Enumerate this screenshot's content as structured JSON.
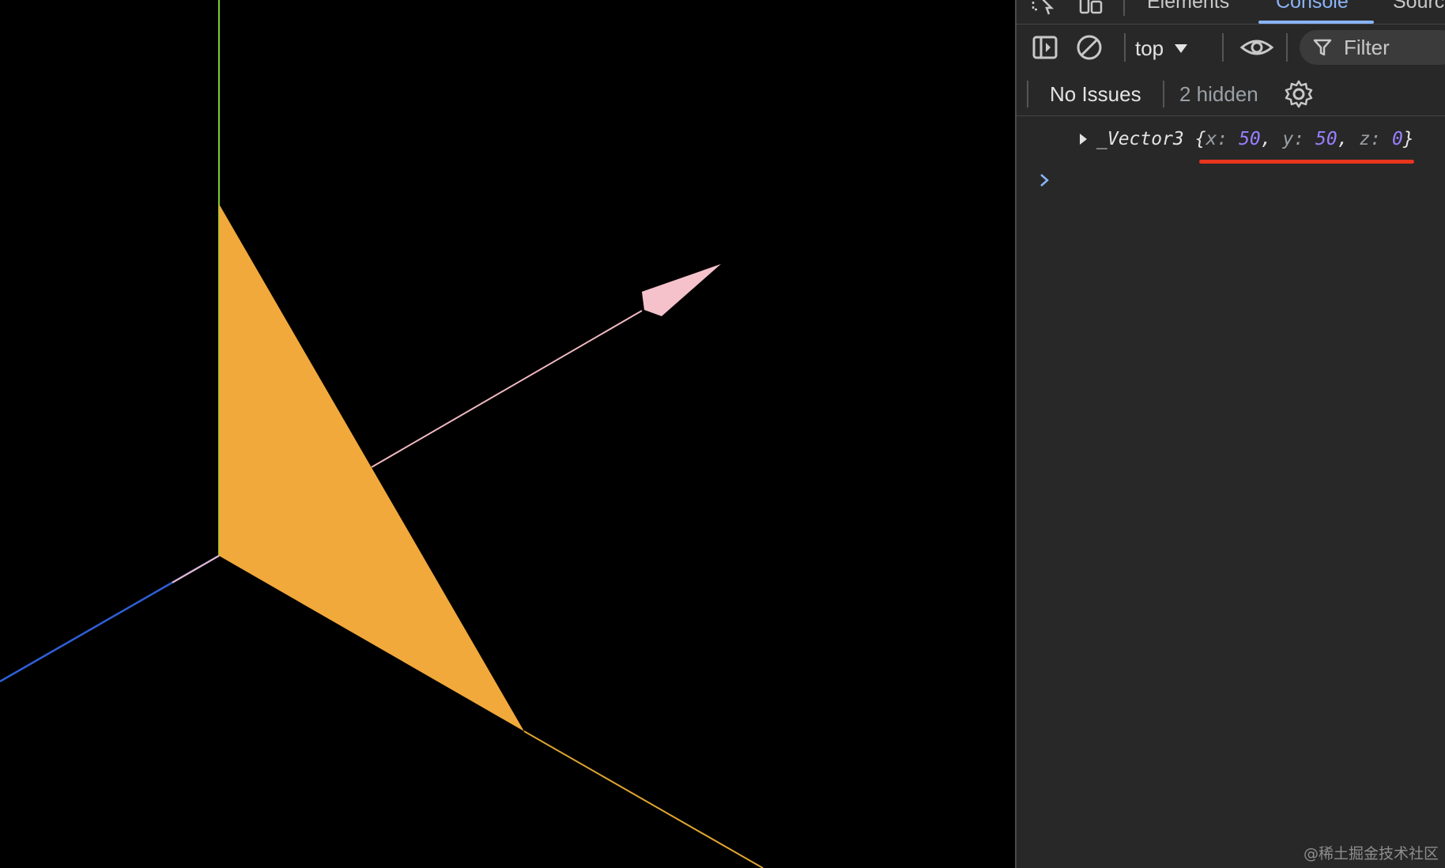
{
  "devtools": {
    "tabs": [
      {
        "label": "Elements",
        "active": false
      },
      {
        "label": "Console",
        "active": true
      },
      {
        "label": "Sources",
        "active": false
      }
    ],
    "toolbar": {
      "context": "top",
      "filter_placeholder": "Filter"
    },
    "issues": {
      "status": "No Issues",
      "hidden": "2 hidden"
    },
    "console": {
      "log_object": {
        "type": "_Vector3",
        "open_brace": "{",
        "close_brace": "}",
        "props": [
          {
            "key": "x",
            "value": "50"
          },
          {
            "key": "y",
            "value": "50"
          },
          {
            "key": "z",
            "value": "0"
          }
        ]
      }
    },
    "colors": {
      "accent": "#8ab4f8",
      "number": "#9980ff",
      "highlight_underline": "#e8351e"
    }
  },
  "scene": {
    "colors": {
      "background": "#000000",
      "y_axis": "#7ccf2e",
      "x_axis": "#e0a531",
      "z_axis": "#2f5fd6",
      "plane": "#f2a93b",
      "arrow": "#f5c2cb"
    }
  },
  "watermark": "@稀土掘金技术社区"
}
